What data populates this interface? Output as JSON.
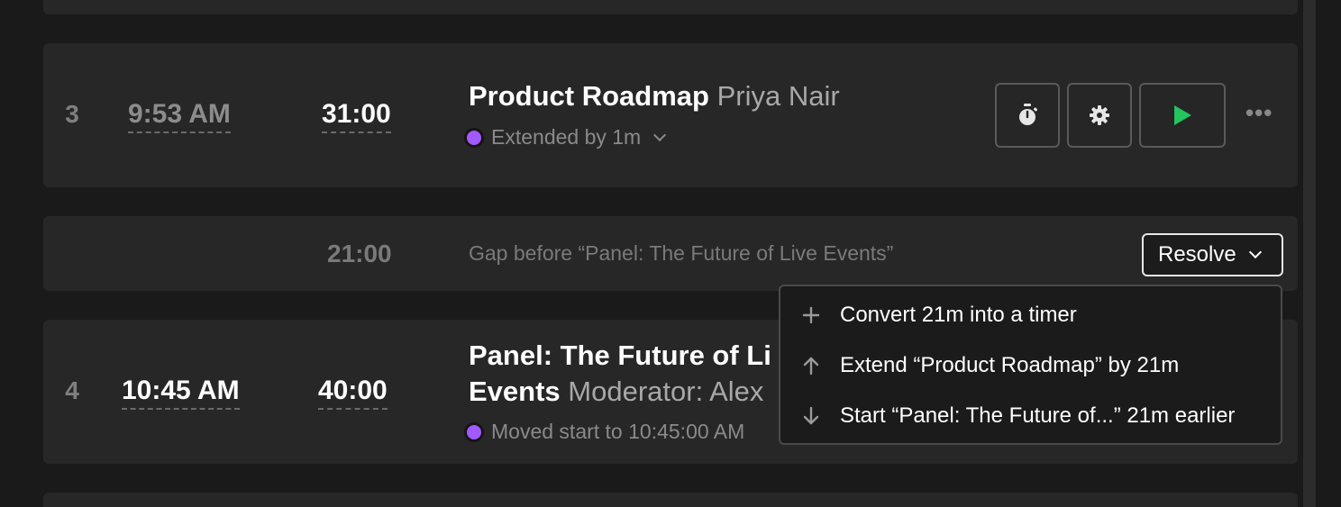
{
  "rows": [
    {
      "number": "3",
      "start_time": "9:53 AM",
      "duration": "31:00",
      "title": "Product Roadmap",
      "speaker": "Priya Nair",
      "status": "Extended by 1m"
    },
    {
      "number": "4",
      "start_time": "10:45 AM",
      "duration": "40:00",
      "title_line1": "Panel: The Future of Li",
      "title_line2": "Events",
      "speaker": "Moderator: Alex",
      "status": "Moved start to 10:45:00 AM"
    }
  ],
  "gap": {
    "duration": "21:00",
    "text": "Gap before “Panel: The Future of Live Events”",
    "resolve_label": "Resolve"
  },
  "resolve_menu": {
    "items": [
      {
        "icon": "plus-icon",
        "label": "Convert 21m into a timer"
      },
      {
        "icon": "arrow-up-icon",
        "label": "Extend “Product Roadmap” by 21m"
      },
      {
        "icon": "arrow-down-icon",
        "label": "Start “Panel: The Future of...” 21m earlier"
      }
    ]
  },
  "icons": {
    "timer": "stopwatch-icon",
    "settings": "gear-icon",
    "play": "play-icon",
    "more": "more-horizontal-icon"
  },
  "colors": {
    "accent_dot": "#a259ff",
    "play_green": "#22c55e",
    "card_bg": "#272727",
    "page_bg": "#1a1a1a"
  }
}
